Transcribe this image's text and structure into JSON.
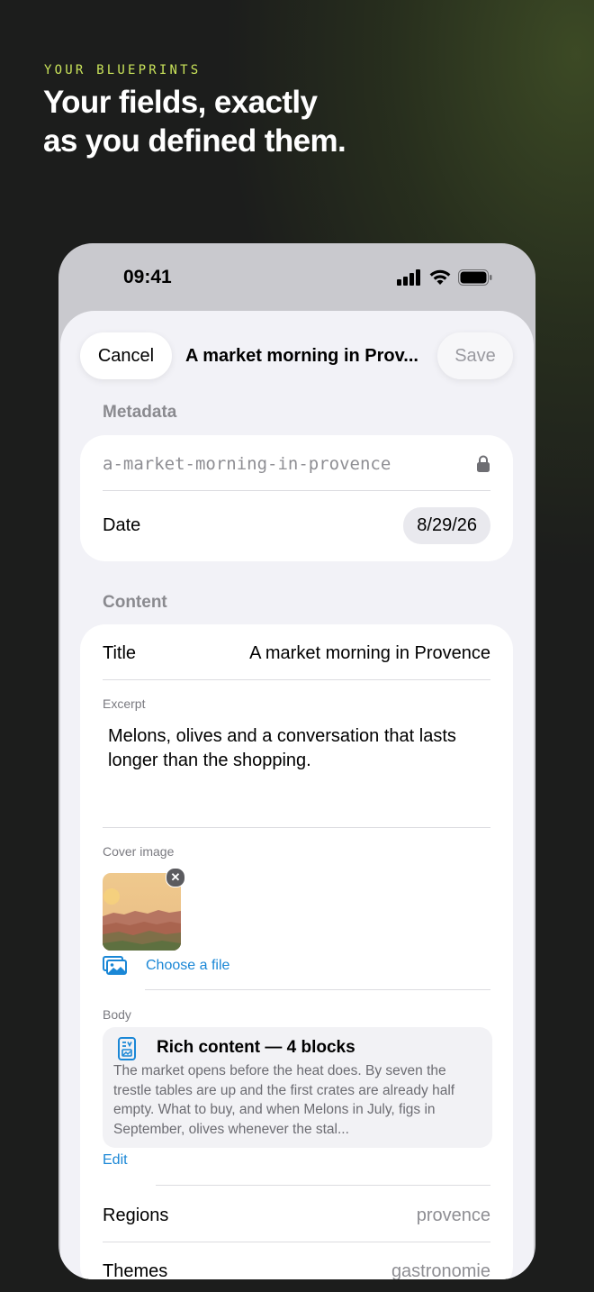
{
  "hero": {
    "eyebrow": "YOUR BLUEPRINTS",
    "headline_line1": "Your fields, exactly",
    "headline_line2": "as you defined them."
  },
  "status_bar": {
    "time": "09:41",
    "icons": [
      "cellular-signal-icon",
      "wifi-icon",
      "battery-icon"
    ]
  },
  "nav": {
    "cancel_label": "Cancel",
    "title": "A market morning in Prov...",
    "save_label": "Save"
  },
  "metadata": {
    "section_label": "Metadata",
    "slug": "a-market-morning-in-provence",
    "date_label": "Date",
    "date_value": "8/29/26"
  },
  "content": {
    "section_label": "Content",
    "title_label": "Title",
    "title_value": "A market morning in Provence",
    "excerpt_label": "Excerpt",
    "excerpt_value": "Melons, olives and a conversation that lasts longer than the shopping.",
    "cover_label": "Cover image",
    "choose_file_label": "Choose a file",
    "body_label": "Body",
    "body_heading": "Rich content — 4 blocks",
    "body_preview": "The market opens before the heat does. By seven the trestle tables are up and the first crates are already half empty. What to buy, and when Melons in July, figs in September, olives whenever the stal...",
    "edit_label": "Edit",
    "regions_label": "Regions",
    "regions_value": "provence",
    "themes_label": "Themes",
    "themes_value": "gastronomie"
  },
  "colors": {
    "accent_link": "#1a87d6",
    "eyebrow": "#c9e35a",
    "background": "#1c1d1c",
    "sheet": "#f2f2f7"
  }
}
